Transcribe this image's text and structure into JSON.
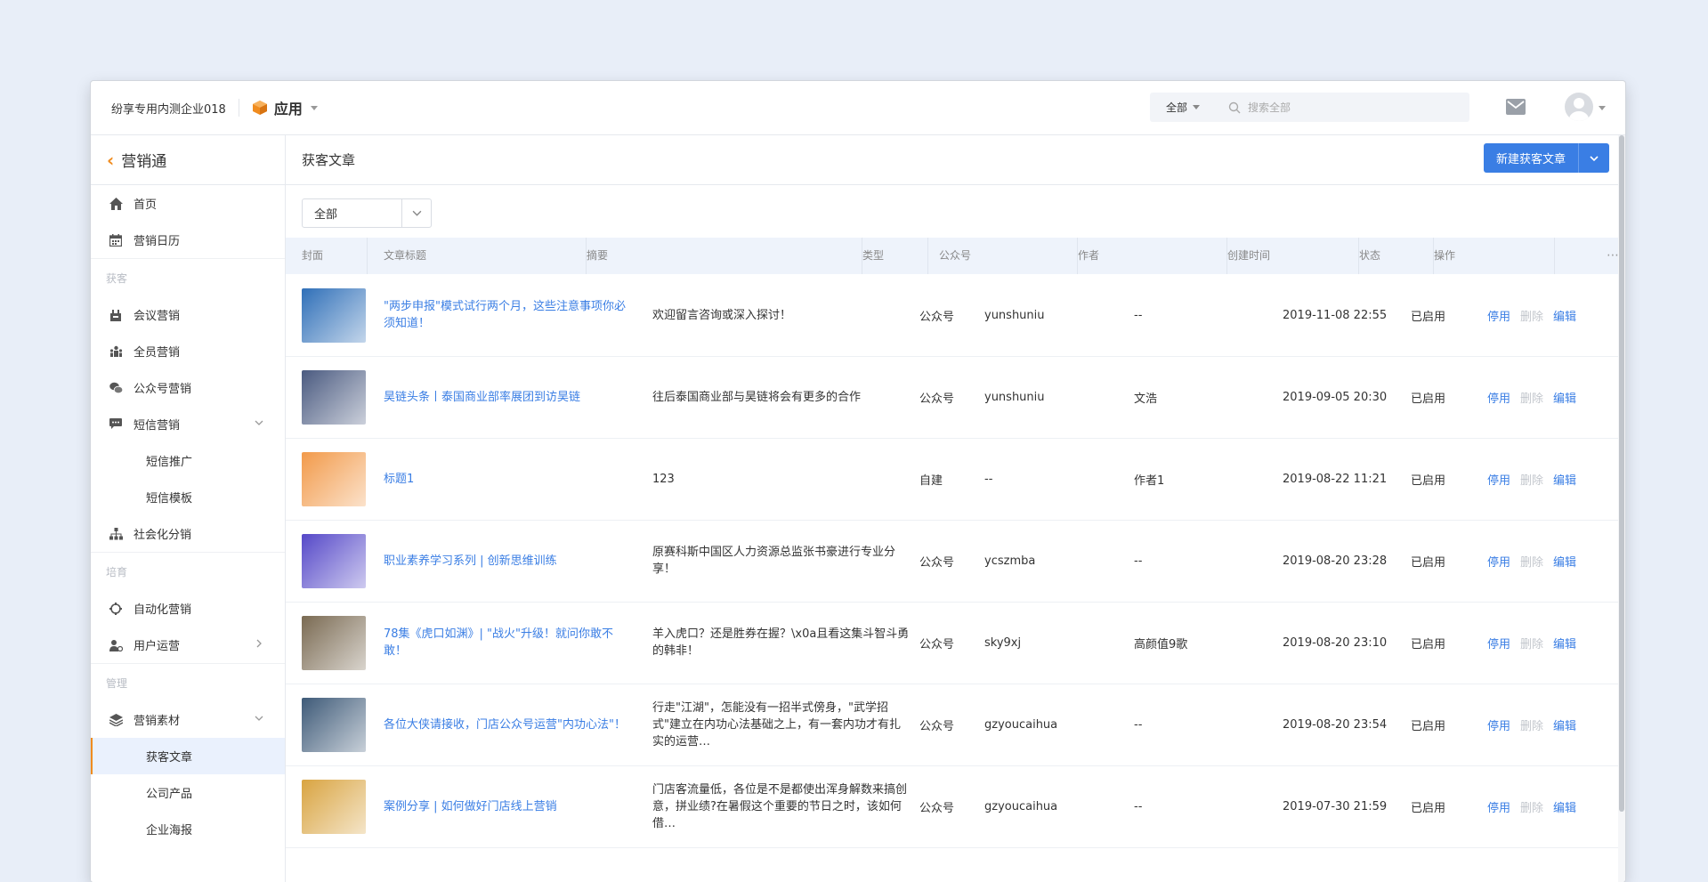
{
  "topbar": {
    "company": "纷享专用内测企业018",
    "app_name": "应用",
    "search_scope": "全部",
    "search_placeholder": "搜索全部"
  },
  "sidebar": {
    "title": "营销通",
    "items": [
      {
        "label": "首页",
        "icon": "home-icon"
      },
      {
        "label": "营销日历",
        "icon": "calendar-icon"
      }
    ],
    "groups": [
      {
        "label": "获客",
        "items": [
          {
            "label": "会议营销",
            "icon": "meeting-icon"
          },
          {
            "label": "全员营销",
            "icon": "people-icon"
          },
          {
            "label": "公众号营销",
            "icon": "wechat-icon"
          },
          {
            "label": "短信营销",
            "icon": "sms-icon",
            "expanded": true
          },
          {
            "label": "短信推广",
            "sub": true
          },
          {
            "label": "短信模板",
            "sub": true
          },
          {
            "label": "社会化分销",
            "icon": "org-tree-icon"
          }
        ]
      },
      {
        "label": "培育",
        "items": [
          {
            "label": "自动化营销",
            "icon": "automation-icon"
          },
          {
            "label": "用户运营",
            "icon": "user-ops-icon"
          }
        ]
      },
      {
        "label": "管理",
        "items": [
          {
            "label": "营销素材",
            "icon": "material-icon",
            "expanded": true
          },
          {
            "label": "获客文章",
            "sub": true,
            "active": true
          },
          {
            "label": "公司产品",
            "sub": true
          },
          {
            "label": "企业海报",
            "sub": true
          }
        ]
      }
    ]
  },
  "main": {
    "title": "获客文章",
    "new_button": "新建获客文章",
    "filter_value": "全部",
    "columns": [
      "封面",
      "文章标题",
      "摘要",
      "类型",
      "公众号",
      "作者",
      "创建时间",
      "状态",
      "操作"
    ],
    "actions": [
      "停用",
      "删除",
      "编辑"
    ],
    "rows": [
      {
        "title": "\"两步申报\"模式试行两个月，这些注意事项你必须知道！",
        "summary": "欢迎留言咨询或深入探讨！",
        "type": "公众号",
        "account": "yunshuniu",
        "author": "--",
        "created": "2019-11-08 22:55",
        "status": "已启用",
        "cover": "cover-tax",
        "cover_color": "#2f6fb8"
      },
      {
        "title": "昊链头条丨泰国商业部率展团到访昊链",
        "summary": "往后泰国商业部与昊链将会有更多的合作",
        "type": "公众号",
        "account": "yunshuniu",
        "author": "文浩",
        "created": "2019-09-05 20:30",
        "status": "已启用",
        "cover": "cover-group-photo",
        "cover_color": "#4a5a80"
      },
      {
        "title": "标题1",
        "summary": "123",
        "type": "自建",
        "account": "--",
        "author": "作者1",
        "created": "2019-08-22 11:21",
        "status": "已启用",
        "cover": "cover-qrcode",
        "cover_color": "#f29a4a"
      },
      {
        "title": "职业素养学习系列 | 创新思维训练",
        "summary": "原赛科斯中国区人力资源总监张书豪进行专业分享！",
        "type": "公众号",
        "account": "ycszmba",
        "author": "--",
        "created": "2019-08-20 23:28",
        "status": "已启用",
        "cover": "cover-training",
        "cover_color": "#5548c8"
      },
      {
        "title": "78集《虎口如渊》| \"战火\"升级！就问你敢不敢！",
        "summary": "羊入虎口？还是胜券在握？\\x0a且看这集斗智斗勇的韩非！",
        "type": "公众号",
        "account": "sky9xj",
        "author": "高颜值9歌",
        "created": "2019-08-20 23:10",
        "status": "已启用",
        "cover": "cover-anime",
        "cover_color": "#7a6a52"
      },
      {
        "title": "各位大侠请接收，门店公众号运营\"内功心法\"！",
        "summary": "行走\"江湖\"，怎能没有一招半式傍身，\"武学招式\"建立在内功心法基础之上，有一套内功才有扎实的运营…",
        "type": "公众号",
        "account": "gzyoucaihua",
        "author": "--",
        "created": "2019-08-20 23:54",
        "status": "已启用",
        "cover": "cover-book",
        "cover_color": "#3e5a78"
      },
      {
        "title": "案例分享 | 如何做好门店线上营销",
        "summary": "门店客流量低，各位是不是都使出浑身解数来搞创意，拼业绩?在暑假这个重要的节日之时，该如何借…",
        "type": "公众号",
        "account": "gzyoucaihua",
        "author": "--",
        "created": "2019-07-30 21:59",
        "status": "已启用",
        "cover": "cover-store",
        "cover_color": "#d9a441"
      }
    ]
  },
  "colors": {
    "accent": "#3a7ee4",
    "orange": "#f08c1f"
  }
}
